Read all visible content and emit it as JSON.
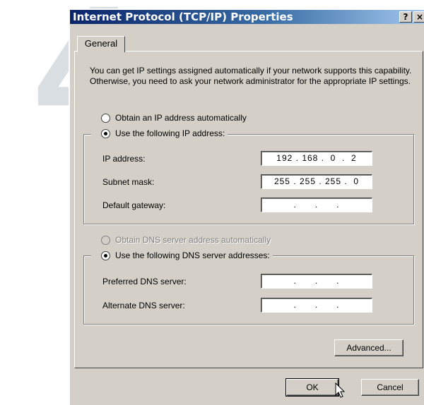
{
  "step_number": "4",
  "window": {
    "title": "Internet Protocol (TCP/IP) Properties",
    "help_btn": "?",
    "close_btn": "×"
  },
  "tab": {
    "label": "General"
  },
  "intro_text": "You can get IP settings assigned automatically if your network supports this capability. Otherwise, you need to ask your network administrator for the appropriate IP settings.",
  "ip_section": {
    "auto_label": "Obtain an IP address automatically",
    "manual_label": "Use the following IP address:",
    "ip_label": "IP address:",
    "ip_value": "192 . 168 .  0  .  2",
    "mask_label": "Subnet mask:",
    "mask_value": "255 . 255 . 255 .  0",
    "gateway_label": "Default gateway:",
    "gateway_value": " .      .      . "
  },
  "dns_section": {
    "auto_label": "Obtain DNS server address automatically",
    "manual_label": "Use the following DNS server addresses:",
    "preferred_label": "Preferred DNS server:",
    "preferred_value": " .      .      . ",
    "alternate_label": "Alternate DNS server:",
    "alternate_value": " .      .      . "
  },
  "buttons": {
    "advanced": "Advanced...",
    "ok": "OK",
    "cancel": "Cancel"
  }
}
